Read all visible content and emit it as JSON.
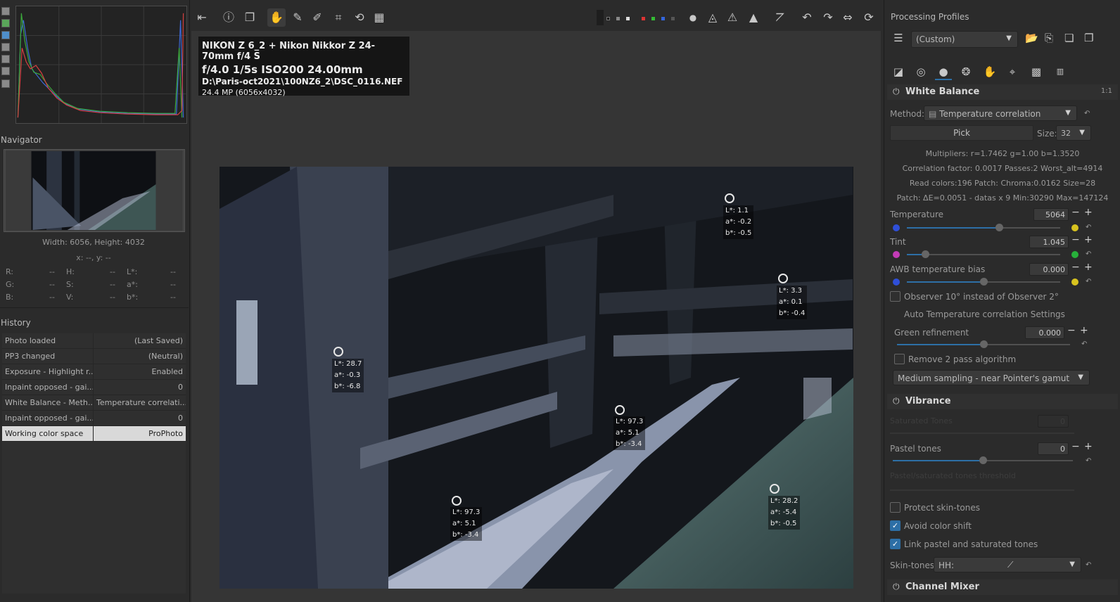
{
  "history_graph": {
    "tools": [
      "histogram-tool-1",
      "histogram-tool-2",
      "histogram-tool-3",
      "histogram-tool-4",
      "histogram-tool-5",
      "histogram-tool-6",
      "histogram-tool-7"
    ]
  },
  "navigator": {
    "title": "Navigator",
    "dimensions": "Width: 6056, Height: 4032",
    "xy": "x: --, y: --",
    "readouts": [
      {
        "k": "R:",
        "v": "--"
      },
      {
        "k": "H:",
        "v": "--"
      },
      {
        "k": "L*:",
        "v": "--"
      },
      {
        "k": "G:",
        "v": "--"
      },
      {
        "k": "S:",
        "v": "--"
      },
      {
        "k": "a*:",
        "v": "--"
      },
      {
        "k": "B:",
        "v": "--"
      },
      {
        "k": "V:",
        "v": "--"
      },
      {
        "k": "b*:",
        "v": "--"
      }
    ]
  },
  "history": {
    "title": "History",
    "rows": [
      {
        "action": "Photo loaded",
        "value": "(Last Saved)"
      },
      {
        "action": "PP3 changed",
        "value": "(Neutral)"
      },
      {
        "action": "Exposure - Highlight r...",
        "value": "Enabled"
      },
      {
        "action": "Inpaint opposed - gai...",
        "value": "0"
      },
      {
        "action": "White Balance - Meth...",
        "value": "Temperature correlati..."
      },
      {
        "action": "Inpaint opposed - gai...",
        "value": "0"
      },
      {
        "action": "Working color space",
        "value": "ProPhoto"
      }
    ]
  },
  "image_info": {
    "camera": "NIKON Z 6_2 + Nikon Nikkor Z 24-70mm f/4 S",
    "exposure": "f/4.0  1/5s  ISO200  24.00mm",
    "path": "D:\\Paris-oct2021\\100NZ6_2\\DSC_0116.NEF",
    "size": "24.4 MP (6056x4032)"
  },
  "samples": [
    {
      "L": "L*: 1.1",
      "a": "a*: -0.2",
      "b": "b*: -0.5"
    },
    {
      "L": "L*: 3.3",
      "a": "a*: 0.1",
      "b": "b*: -0.4"
    },
    {
      "L": "L*: 28.7",
      "a": "a*: -0.3",
      "b": "b*: -6.8"
    },
    {
      "L": "L*: 97.3",
      "a": "a*: 5.1",
      "b": "b*: -3.4"
    },
    {
      "L": "L*: 97.3",
      "a": "a*: 5.1",
      "b": "b*: -3.4"
    },
    {
      "L": "L*: 28.2",
      "a": "a*: -5.4",
      "b": "b*: -0.5"
    }
  ],
  "processing_profiles": {
    "title": "Processing Profiles",
    "selected": "(Custom)"
  },
  "white_balance": {
    "title": "White Balance",
    "one_to_one": "1:1",
    "method_label": "Method:",
    "method_value": "Temperature correlation",
    "pick_label": "Pick",
    "size_label": "Size:",
    "size_value": "32",
    "multipliers": "Multipliers: r=1.7462 g=1.00 b=1.3520",
    "correlation": "Correlation factor: 0.0017 Passes:2 Worst_alt=4914",
    "read_colors": "Read colors:196 Patch: Chroma:0.0162 Size=28",
    "patch": "Patch: ΔE=0.0051 - datas x 9 Min:30290 Max=147124",
    "temperature_label": "Temperature",
    "temperature_value": "5064",
    "temperature_level": 0.6,
    "tint_label": "Tint",
    "tint_value": "1.045",
    "tint_level": 0.12,
    "awb_label": "AWB temperature bias",
    "awb_value": "0.000",
    "awb_level": 0.5,
    "observer_label": "Observer 10° instead of Observer 2°",
    "auto_settings_label": "Auto Temperature correlation Settings",
    "green_label": "Green refinement",
    "green_value": "0.000",
    "green_level": 0.5,
    "remove_pass_label": "Remove 2 pass algorithm",
    "sampling_value": "Medium sampling - near Pointer's gamut"
  },
  "vibrance": {
    "title": "Vibrance",
    "saturated_label": "Saturated Tones",
    "saturated_value": "0",
    "pastel_label": "Pastel tones",
    "pastel_value": "0",
    "pastel_level": 0.5,
    "threshold_label": "Pastel/saturated tones threshold",
    "protect_label": "Protect skin-tones",
    "avoid_label": "Avoid color shift",
    "link_label": "Link pastel and saturated tones",
    "skin_label": "Skin-tones:",
    "skin_value": "HH:"
  },
  "channel_mixer": {
    "title": "Channel Mixer"
  },
  "colors": {
    "accent": "#2d6fa6",
    "selected_row": "#d9d9d9",
    "temp_blue": "#2f4fd8",
    "temp_yellow": "#d8c31f",
    "tint_magenta": "#c43bb7",
    "tint_green": "#27b03a"
  }
}
